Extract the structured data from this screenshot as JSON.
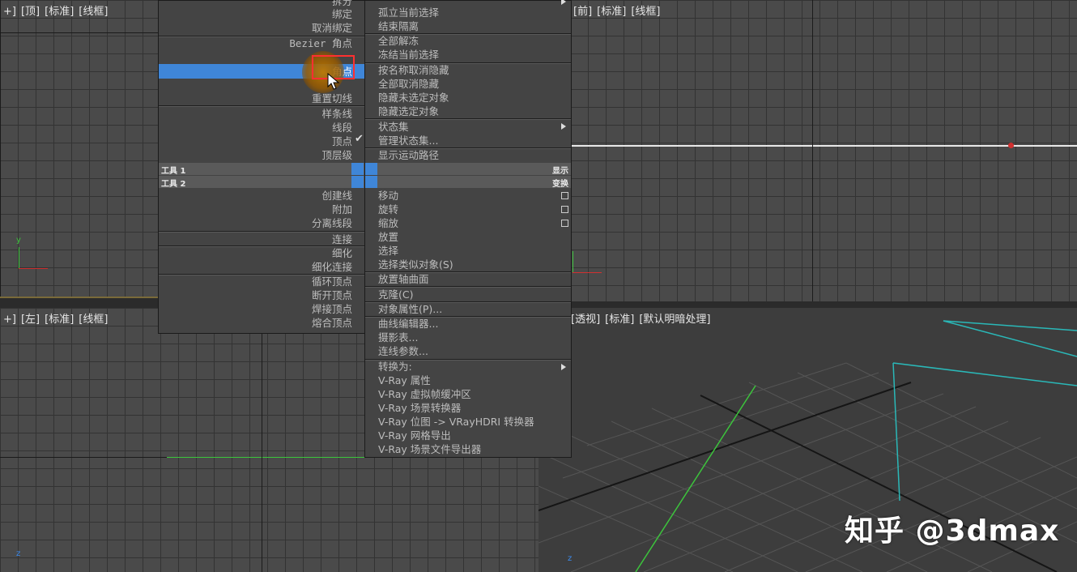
{
  "viewports": {
    "top": [
      "+]",
      "[顶]",
      "[标准]",
      "[线框]"
    ],
    "front": [
      "[前]",
      "[标准]",
      "[线框]"
    ],
    "left": [
      "+]",
      "[左]",
      "[标准]",
      "[线框]"
    ],
    "persp": [
      "[透视]",
      "[标准]",
      "[默认明暗处理]"
    ]
  },
  "menu_left": {
    "items": [
      "拆分",
      "绑定",
      "取消绑定",
      "Bezier 角点",
      "角点",
      "重置切线",
      "样条线",
      "线段",
      "顶点",
      "顶层级",
      "创建线",
      "附加",
      "分离线段",
      "连接",
      "细化",
      "细化连接",
      "循环顶点",
      "断开顶点",
      "焊接顶点",
      "熔合顶点"
    ],
    "quad_tools1": "工具 1",
    "quad_tools2": "工具 2"
  },
  "menu_right": {
    "items": [
      "孤立当前选择",
      "结束隔离",
      "全部解冻",
      "冻结当前选择",
      "按名称取消隐藏",
      "全部取消隐藏",
      "隐藏未选定对象",
      "隐藏选定对象",
      "状态集",
      "管理状态集...",
      "显示运动路径",
      "移动",
      "旋转",
      "缩放",
      "放置",
      "选择",
      "选择类似对象(S)",
      "放置轴曲面",
      "克隆(C)",
      "对象属性(P)...",
      "曲线编辑器...",
      "摄影表...",
      "连线参数...",
      "转换为:",
      "V-Ray 属性",
      "V-Ray 虚拟帧缓冲区",
      "V-Ray 场景转换器",
      "V-Ray 位图 -> VRayHDRI 转换器",
      "V-Ray 网格导出",
      "V-Ray 场景文件导出器"
    ],
    "quad_display": "显示",
    "quad_transform": "变换"
  },
  "axis": {
    "y": "y",
    "z": "z"
  },
  "watermark": "知乎 @3dmax",
  "colors": {
    "highlight": "#3f86d8",
    "menu_bg": "#444444",
    "grid": "#4a4a4a",
    "red_box": "#ff3030"
  }
}
